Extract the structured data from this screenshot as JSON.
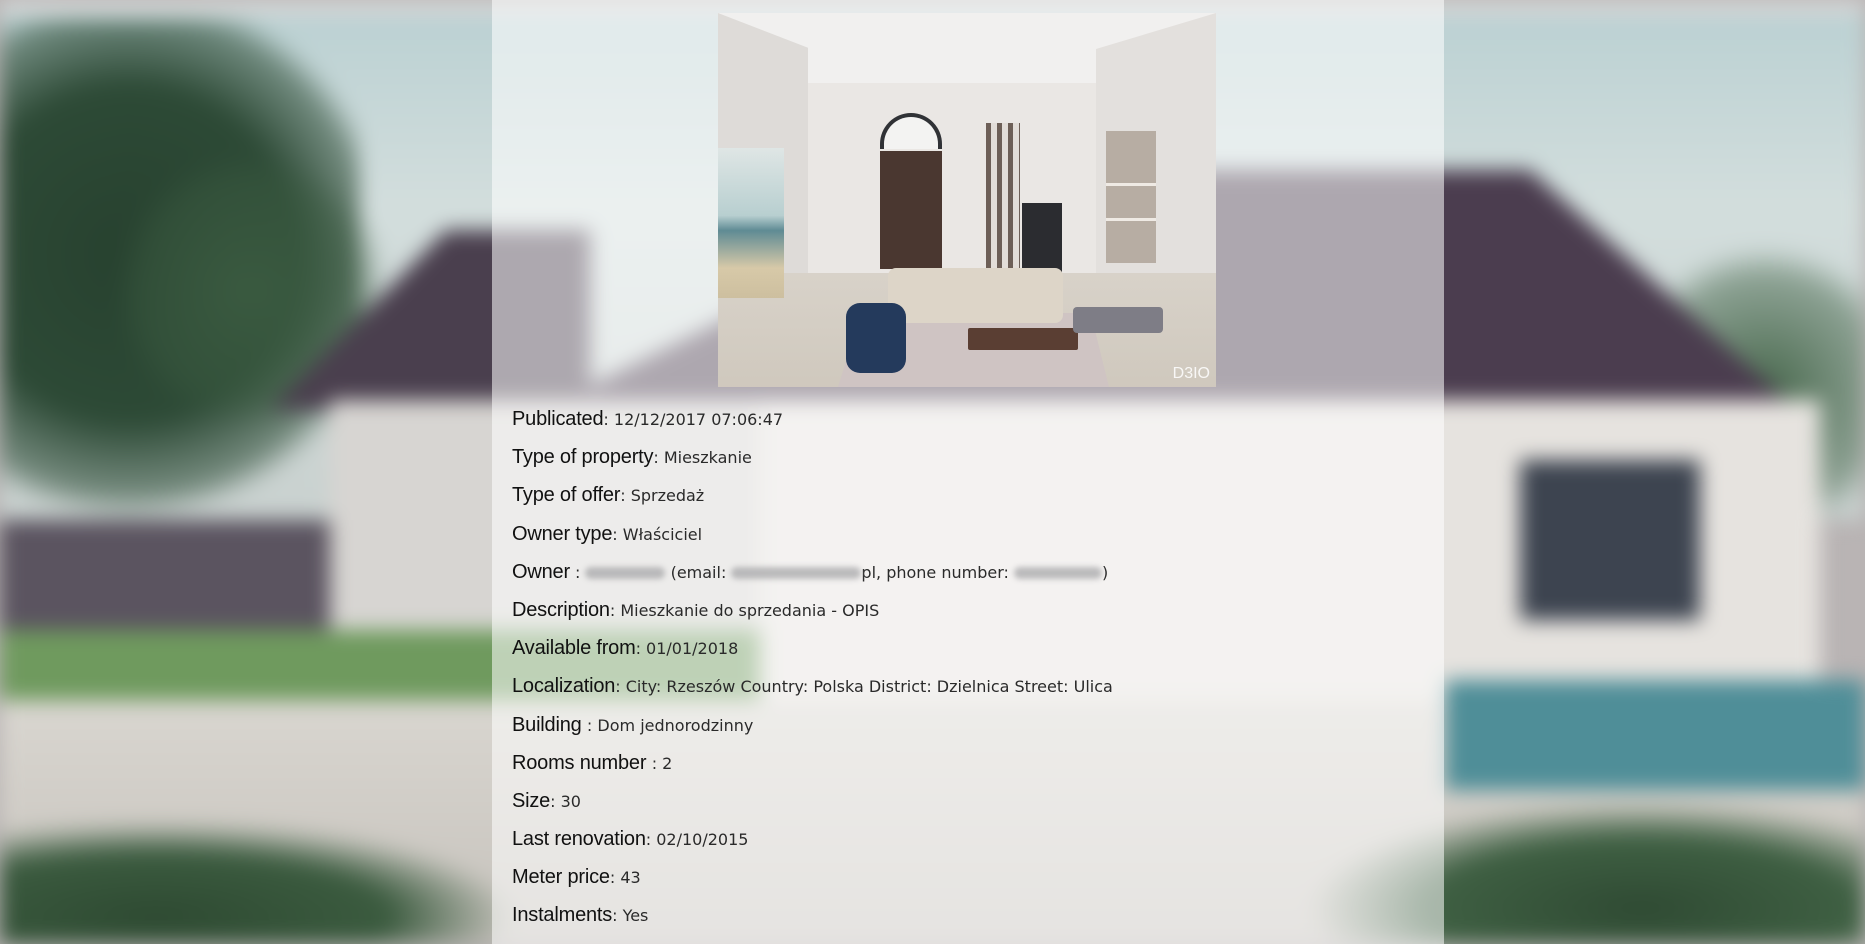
{
  "listing": {
    "publicated": {
      "label": "Publicated",
      "sep": ": ",
      "value": "12/12/2017 07:06:47"
    },
    "type_of_property": {
      "label": "Type of property",
      "sep": ": ",
      "value": "Mieszkanie"
    },
    "type_of_offer": {
      "label": "Type of offer",
      "sep": ": ",
      "value": "Sprzedaż"
    },
    "owner_type": {
      "label": "Owner type",
      "sep": ": ",
      "value": "Właściciel"
    },
    "owner": {
      "label": "Owner",
      "sep": " : ",
      "email_prefix": " (email: ",
      "email_suffix": "pl",
      "phone_prefix": ", phone number: ",
      "close": ")"
    },
    "description": {
      "label": "Description",
      "sep": ": ",
      "value": "Mieszkanie do sprzedania - OPIS"
    },
    "available_from": {
      "label": "Available from",
      "sep": ": ",
      "value": "01/01/2018"
    },
    "localization": {
      "label": "Localization",
      "sep": ": ",
      "value": "City: Rzeszów Country: Polska District: Dzielnica Street: Ulica"
    },
    "building": {
      "label": "Building ",
      "sep": ": ",
      "value": "Dom jednorodzinny"
    },
    "rooms_number": {
      "label": "Rooms number ",
      "sep": ": ",
      "value": "2"
    },
    "size": {
      "label": "Size",
      "sep": ": ",
      "value": "30"
    },
    "last_renovation": {
      "label": "Last renovation",
      "sep": ": ",
      "value": "02/10/2015"
    },
    "meter_price": {
      "label": "Meter price",
      "sep": ": ",
      "value": "43"
    },
    "instalments": {
      "label": "Instalments",
      "sep": ": ",
      "value": "Yes"
    }
  },
  "photo": {
    "watermark": "D3IO"
  }
}
